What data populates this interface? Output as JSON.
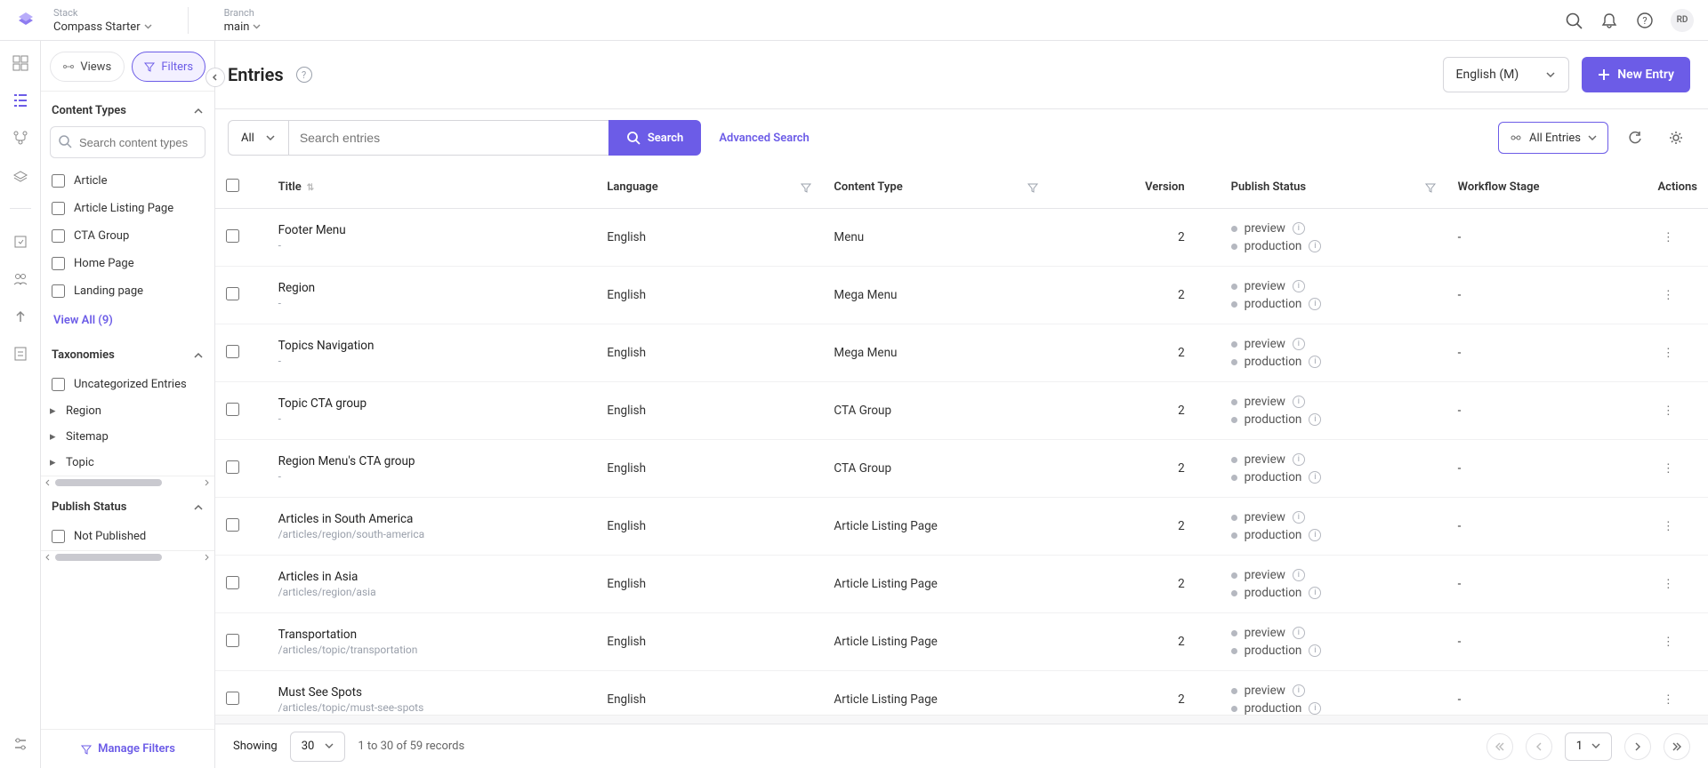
{
  "top": {
    "stack_label": "Stack",
    "stack_value": "Compass Starter",
    "branch_label": "Branch",
    "branch_value": "main",
    "avatar_initials": "RD"
  },
  "sidebar": {
    "views_tab": "Views",
    "filters_tab": "Filters",
    "content_types_header": "Content Types",
    "search_placeholder": "Search content types",
    "content_types": [
      "Article",
      "Article Listing Page",
      "CTA Group",
      "Home Page",
      "Landing page"
    ],
    "view_all": "View All (9)",
    "taxonomies_header": "Taxonomies",
    "uncategorized": "Uncategorized Entries",
    "taxonomies": [
      "Region",
      "Sitemap",
      "Topic"
    ],
    "publish_status_header": "Publish Status",
    "not_published": "Not Published",
    "manage_filters": "Manage Filters"
  },
  "header": {
    "title": "Entries",
    "language": "English (M)",
    "new_entry": "New Entry"
  },
  "search": {
    "type": "All",
    "placeholder": "Search entries",
    "button": "Search",
    "advanced": "Advanced Search",
    "all_entries": "All Entries"
  },
  "columns": {
    "title": "Title",
    "language": "Language",
    "content_type": "Content Type",
    "version": "Version",
    "publish_status": "Publish Status",
    "workflow_stage": "Workflow Stage",
    "actions": "Actions"
  },
  "publish_labels": {
    "preview": "preview",
    "production": "production"
  },
  "rows": [
    {
      "title": "Footer Menu",
      "sub": "-",
      "lang": "English",
      "ct": "Menu",
      "ver": "2",
      "wf": "-"
    },
    {
      "title": "Region",
      "sub": "-",
      "lang": "English",
      "ct": "Mega Menu",
      "ver": "2",
      "wf": "-"
    },
    {
      "title": "Topics Navigation",
      "sub": "-",
      "lang": "English",
      "ct": "Mega Menu",
      "ver": "2",
      "wf": "-"
    },
    {
      "title": "Topic CTA group",
      "sub": "-",
      "lang": "English",
      "ct": "CTA Group",
      "ver": "2",
      "wf": "-"
    },
    {
      "title": "Region Menu's CTA group",
      "sub": "-",
      "lang": "English",
      "ct": "CTA Group",
      "ver": "2",
      "wf": "-"
    },
    {
      "title": "Articles in South America",
      "sub": "/articles/region/south-america",
      "lang": "English",
      "ct": "Article Listing Page",
      "ver": "2",
      "wf": "-"
    },
    {
      "title": "Articles in Asia",
      "sub": "/articles/region/asia",
      "lang": "English",
      "ct": "Article Listing Page",
      "ver": "2",
      "wf": "-"
    },
    {
      "title": "Transportation",
      "sub": "/articles/topic/transportation",
      "lang": "English",
      "ct": "Article Listing Page",
      "ver": "2",
      "wf": "-"
    },
    {
      "title": "Must See Spots",
      "sub": "/articles/topic/must-see-spots",
      "lang": "English",
      "ct": "Article Listing Page",
      "ver": "2",
      "wf": "-"
    }
  ],
  "footer": {
    "showing": "Showing",
    "per_page": "30",
    "range": "1 to 30 of 59 records",
    "page": "1"
  }
}
